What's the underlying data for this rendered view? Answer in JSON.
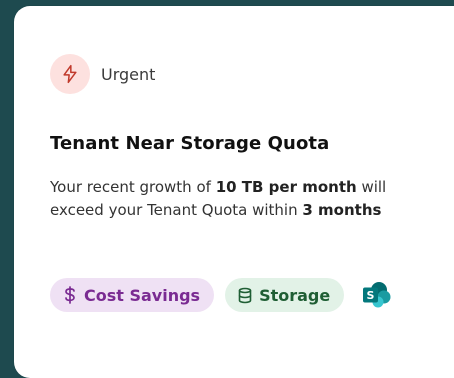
{
  "card": {
    "priority_label": "Urgent",
    "priority_icon": "lightning-bolt-icon",
    "title": "Tenant Near Storage Quota",
    "description": {
      "part1": "Your recent growth of ",
      "bold1": "10 TB per month",
      "part2": " will exceed your Tenant Quota within ",
      "bold2": "3 months"
    },
    "tags": [
      {
        "label": "Cost Savings",
        "icon": "dollar-sign-icon"
      },
      {
        "label": "Storage",
        "icon": "database-icon"
      }
    ],
    "app_icon": "sharepoint-icon"
  },
  "colors": {
    "background": "#1e4a4f",
    "urgent_bg": "#fde1df",
    "urgent_icon": "#c0392b",
    "cost_bg": "#efe1f4",
    "cost_text": "#7a2b92",
    "storage_bg": "#e2f2e7",
    "storage_text": "#1f5e34",
    "sharepoint": "#038387"
  }
}
